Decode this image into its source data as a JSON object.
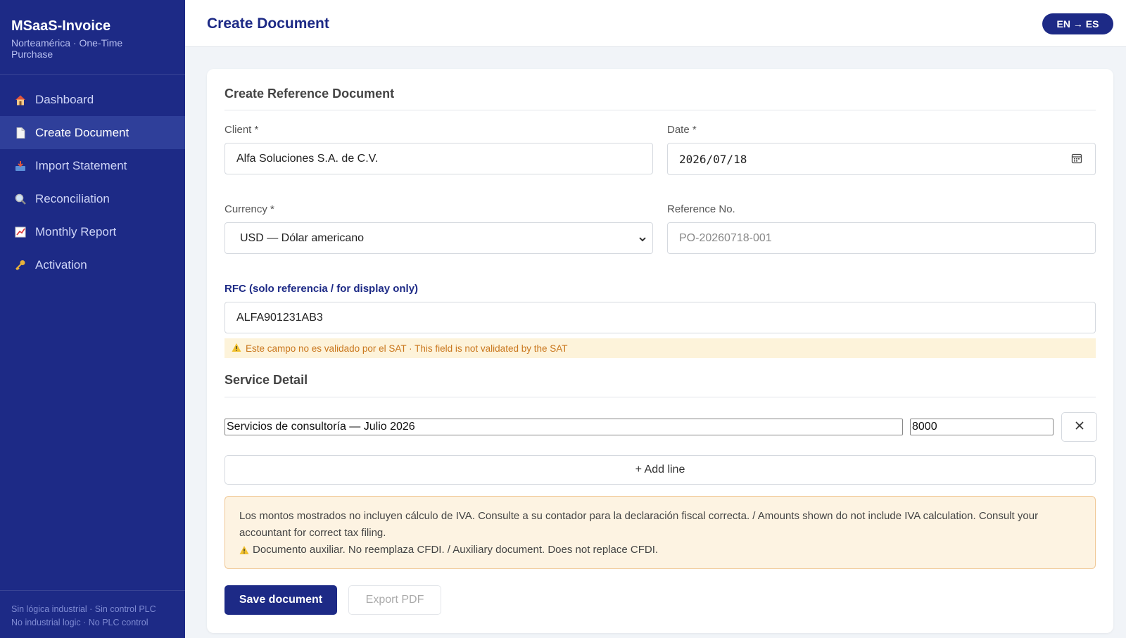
{
  "sidebar": {
    "brand_title": "MSaaS-Invoice",
    "brand_subtitle": "Norteamérica · One-Time Purchase",
    "items": [
      {
        "label": "Dashboard",
        "icon": "house-icon"
      },
      {
        "label": "Create Document",
        "icon": "document-icon",
        "active": true
      },
      {
        "label": "Import Statement",
        "icon": "inbox-tray-icon"
      },
      {
        "label": "Reconciliation",
        "icon": "magnifier-icon"
      },
      {
        "label": "Monthly Report",
        "icon": "chart-icon"
      },
      {
        "label": "Activation",
        "icon": "key-icon"
      }
    ],
    "footer_line1": "Sin lógica industrial · Sin control PLC",
    "footer_line2": "No industrial logic · No PLC control"
  },
  "header": {
    "title": "Create Document",
    "lang_toggle": "EN → ES"
  },
  "form": {
    "section_title": "Create Reference Document",
    "client_label": "Client *",
    "client_value": "Alfa Soluciones S.A. de C.V.",
    "date_label": "Date *",
    "date_value": "2026/07/18",
    "currency_label": "Currency *",
    "currency_value": "USD — Dólar americano",
    "reference_label": "Reference No.",
    "reference_placeholder": "PO-20260718-001",
    "rfc_label": "RFC (solo referencia / for display only)",
    "rfc_value": "ALFA901231AB3",
    "rfc_warning": "Este campo no es validado por el SAT · This field is not validated by the SAT"
  },
  "service": {
    "section_title": "Service Detail",
    "lines": [
      {
        "description": "Servicios de consultoría — Julio 2026",
        "amount": "8000"
      }
    ],
    "add_line_label": "+ Add line"
  },
  "notice": {
    "line1": "Los montos mostrados no incluyen cálculo de IVA. Consulte a su contador para la declaración fiscal correcta. / Amounts shown do not include IVA calculation. Consult your accountant for correct tax filing.",
    "line2": "Documento auxiliar. No reemplaza CFDI. / Auxiliary document. Does not replace CFDI."
  },
  "actions": {
    "save_label": "Save document",
    "export_label": "Export PDF"
  },
  "colors": {
    "sidebar_bg": "#1d2a86",
    "accent": "#1d2a86",
    "warning_text": "#c9761c",
    "notice_bg": "#fdf3e2"
  }
}
